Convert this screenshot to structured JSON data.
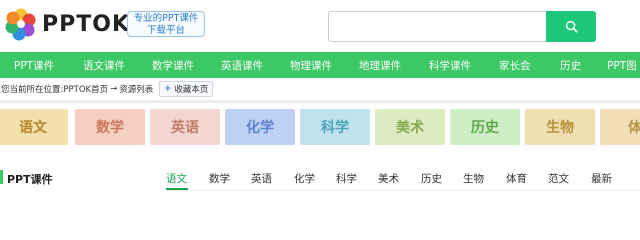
{
  "brand": {
    "name": "PPTOK",
    "slogan_line1": "专业的PPT课件",
    "slogan_line2": "下载平台"
  },
  "search": {
    "placeholder": "",
    "button_icon": "search-icon"
  },
  "nav": {
    "items": [
      "PPT课件",
      "语文课件",
      "数学课件",
      "英语课件",
      "物理课件",
      "地理课件",
      "科学课件",
      "家长会",
      "历史",
      "PPT图"
    ]
  },
  "breadcrumb": {
    "prefix": "您当前所在位置:",
    "home": "PPTOK首页",
    "arrow": "→",
    "current": "资源列表",
    "favorite_label": "收藏本页",
    "favorite_icon": "plus-icon"
  },
  "subjects": [
    {
      "label": "语文",
      "bg": "#f2e0ad",
      "color": "#b8862a"
    },
    {
      "label": "数学",
      "bg": "#f5cfc0",
      "color": "#c9785e"
    },
    {
      "label": "英语",
      "bg": "#f3d6cf",
      "color": "#c47c6c"
    },
    {
      "label": "化学",
      "bg": "#bfd0f5",
      "color": "#5d83cf"
    },
    {
      "label": "科学",
      "bg": "#bfe2ec",
      "color": "#4fa3bb"
    },
    {
      "label": "美术",
      "bg": "#dcebc0",
      "color": "#86aa4f"
    },
    {
      "label": "历史",
      "bg": "#cfeec6",
      "color": "#5ea84c"
    },
    {
      "label": "生物",
      "bg": "#efe0b4",
      "color": "#b89139"
    },
    {
      "label": "体",
      "bg": "#f1dfb8",
      "color": "#b9914a"
    }
  ],
  "section": {
    "title": "PPT课件",
    "tabs": [
      "语文",
      "数学",
      "英语",
      "化学",
      "科学",
      "美术",
      "历史",
      "生物",
      "体育",
      "范文",
      "最新"
    ],
    "active_tab": "语文"
  },
  "colors": {
    "brand_green": "#3cc864",
    "search_button": "#1ec67a",
    "active_tab": "#1e9e52"
  }
}
